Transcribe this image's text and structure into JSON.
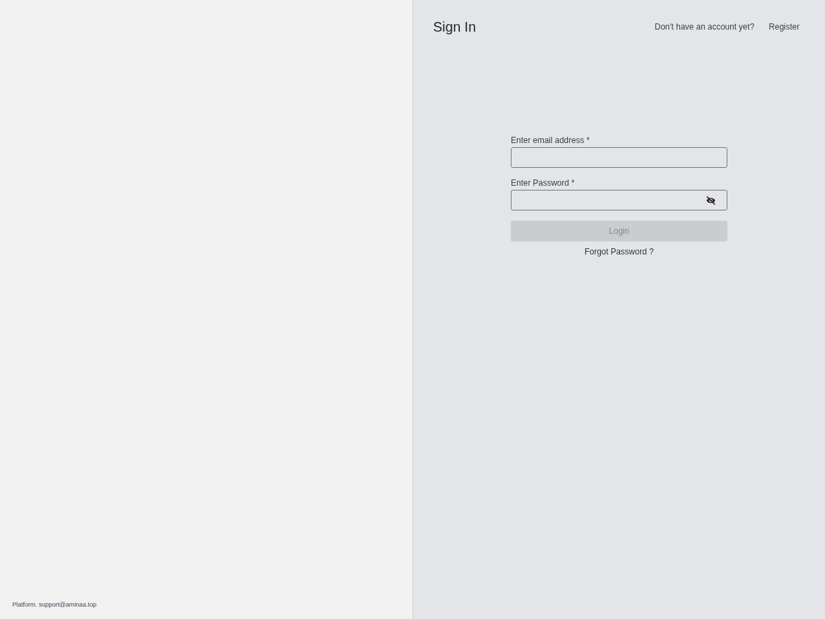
{
  "footer": {
    "text": "Platform. support@aminaa.top"
  },
  "header": {
    "title": "Sign In",
    "prompt": "Don't have an account yet?",
    "link": "Register"
  },
  "form": {
    "fields": [
      {
        "label": "Enter email address *",
        "kind": "text"
      },
      {
        "label": "Enter Password *",
        "kind": "password"
      }
    ],
    "login_button": {
      "label": "Login",
      "disabled": true
    },
    "forgot_link": "Forgot Password ?"
  }
}
